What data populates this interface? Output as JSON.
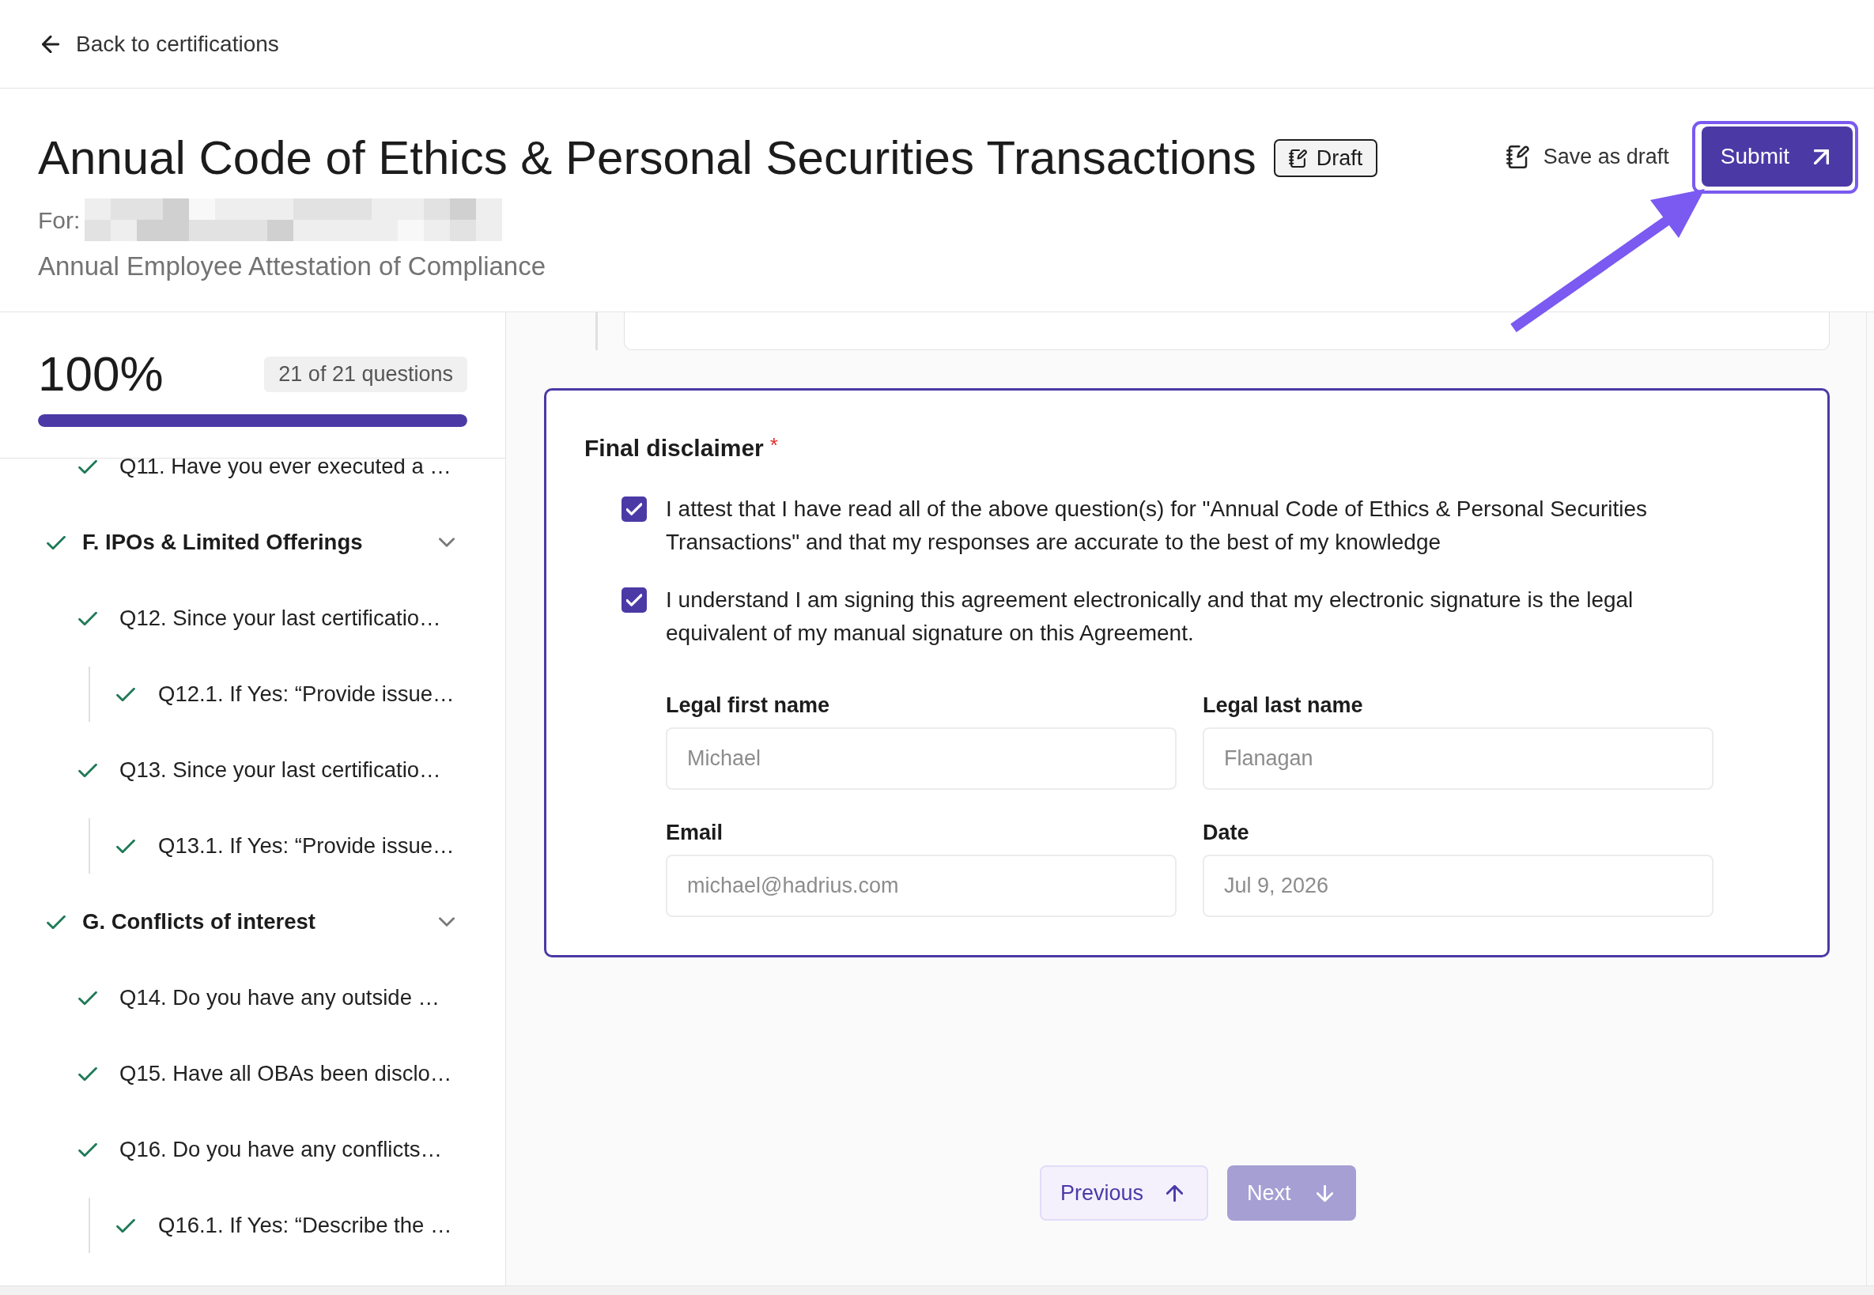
{
  "back_link": {
    "label": "Back to certifications"
  },
  "header": {
    "title": "Annual Code of Ethics & Personal Securities Transactions",
    "status": "Draft",
    "for": {
      "label": "For:",
      "redacted": true
    },
    "subtitle": "Annual Employee Attestation of Compliance",
    "actions": [
      {
        "kind": "draft",
        "label": "Save as draft"
      },
      {
        "kind": "submit",
        "label": "Submit",
        "highlighted": true
      }
    ]
  },
  "progress": {
    "percent": "100%",
    "count": "21 of 21 questions",
    "level": 1
  },
  "outline": [
    {
      "kind": "question",
      "label": "Q11. Have you ever executed a …",
      "completed": true
    },
    {
      "kind": "section",
      "label": "F. IPOs & Limited Offerings",
      "completed": true,
      "expanded": true,
      "children": [
        {
          "kind": "question",
          "label": "Q12. Since your last certificatio…",
          "completed": true,
          "children": [
            {
              "kind": "question",
              "label": "Q12.1. If Yes: “Provide issue…",
              "completed": true
            }
          ]
        },
        {
          "kind": "question",
          "label": "Q13. Since your last certificatio…",
          "completed": true,
          "children": [
            {
              "kind": "question",
              "label": "Q13.1. If Yes: “Provide issue…",
              "completed": true
            }
          ]
        }
      ]
    },
    {
      "kind": "section",
      "label": "G. Conflicts of interest",
      "completed": true,
      "expanded": true,
      "children": [
        {
          "kind": "question",
          "label": "Q14. Do you have any outside …",
          "completed": true
        },
        {
          "kind": "question",
          "label": "Q15. Have all OBAs been disclo…",
          "completed": true
        },
        {
          "kind": "question",
          "label": "Q16. Do you have any conflicts…",
          "completed": true,
          "children": [
            {
              "kind": "question",
              "label": "Q16.1. If Yes: “Describe the …",
              "completed": true
            }
          ]
        }
      ]
    }
  ],
  "disclaimer": {
    "title": "Final disclaimer",
    "required_mark": "*",
    "checkboxes": [
      {
        "label": "I attest that I have read all of the above question(s) for \"Annual Code of Ethics & Personal Securities Transactions\" and that my responses are accurate to the best of my knowledge",
        "checked": true
      },
      {
        "label": "I understand I am signing this agreement electronically and that my electronic signature is the legal equivalent of my manual signature on this Agreement.",
        "checked": true
      }
    ],
    "fields": [
      {
        "label": "Legal first name",
        "value": "Michael",
        "disabled": true
      },
      {
        "label": "Legal last name",
        "value": "Flanagan",
        "disabled": true
      },
      {
        "label": "Email",
        "value": "michael@hadrius.com",
        "disabled": true
      },
      {
        "label": "Date",
        "value": "Jul 9, 2026",
        "disabled": true
      }
    ]
  },
  "navigation": [
    {
      "kind": "previous",
      "label": "Previous",
      "disabled": false
    },
    {
      "kind": "next",
      "label": "Next",
      "disabled": true
    }
  ]
}
